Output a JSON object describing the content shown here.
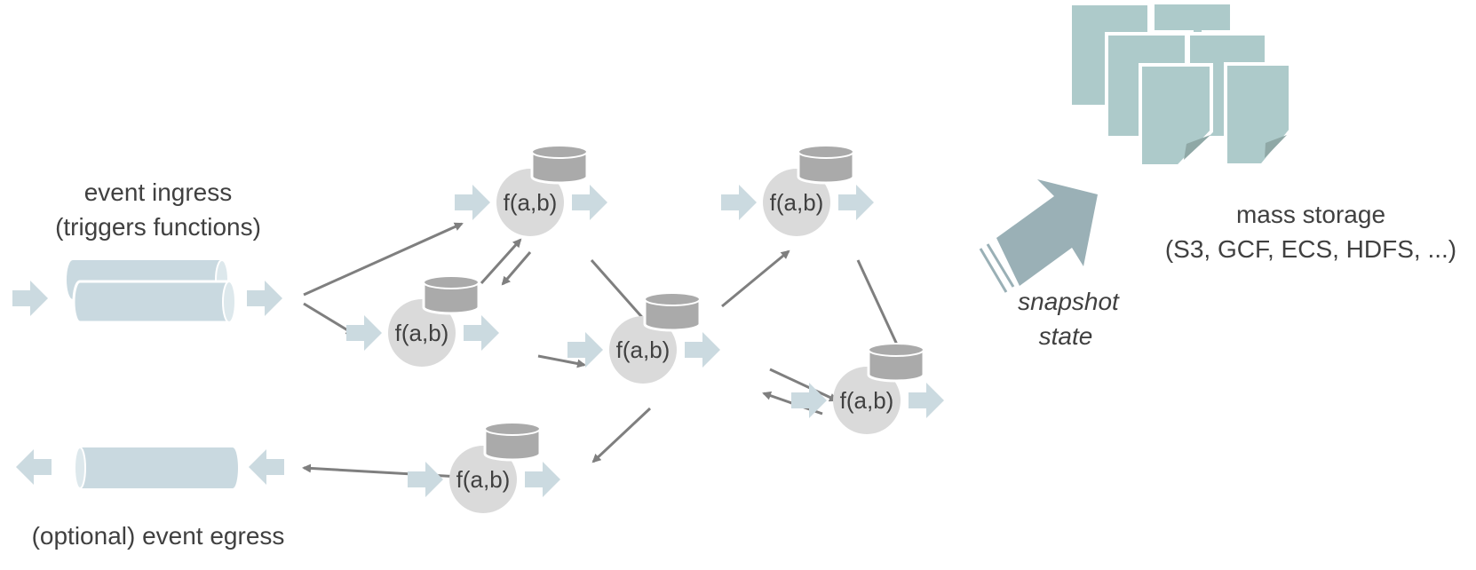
{
  "labels": {
    "ingress_line1": "event ingress",
    "ingress_line2": "(triggers functions)",
    "egress": "(optional) event egress",
    "snapshot_line1": "snapshot",
    "snapshot_line2": "state",
    "storage_line1": "mass storage",
    "storage_line2": "(S3, GCF, ECS, HDFS, ...)"
  },
  "functions": [
    {
      "id": "fn-1",
      "label": "f(a,b)"
    },
    {
      "id": "fn-2",
      "label": "f(a,b)"
    },
    {
      "id": "fn-3",
      "label": "f(a,b)"
    },
    {
      "id": "fn-4",
      "label": "f(a,b)"
    },
    {
      "id": "fn-5",
      "label": "f(a,b)"
    },
    {
      "id": "fn-6",
      "label": "f(a,b)"
    }
  ],
  "edges": [
    {
      "from": "ingress",
      "to": "fn-1"
    },
    {
      "from": "ingress",
      "to": "fn-2"
    },
    {
      "from": "fn-2",
      "to": "fn-1"
    },
    {
      "from": "fn-1",
      "to": "fn-2"
    },
    {
      "from": "fn-1",
      "to": "fn-3"
    },
    {
      "from": "fn-2",
      "to": "fn-3"
    },
    {
      "from": "fn-3",
      "to": "fn-4"
    },
    {
      "from": "fn-4",
      "to": "fn-5"
    },
    {
      "from": "fn-3",
      "to": "fn-5"
    },
    {
      "from": "fn-5",
      "to": "fn-3"
    },
    {
      "from": "fn-3",
      "to": "fn-6"
    },
    {
      "from": "fn-6",
      "to": "egress"
    }
  ],
  "colors": {
    "flow_arrow": "#cbdae0",
    "queue": "#c9d9e0",
    "node": "#dadada",
    "db": "#aaaaaa",
    "edge": "#7f7f7f",
    "storage": "#adcaca",
    "snapshot_arrow": "#9ab0b6",
    "text": "#404040"
  }
}
